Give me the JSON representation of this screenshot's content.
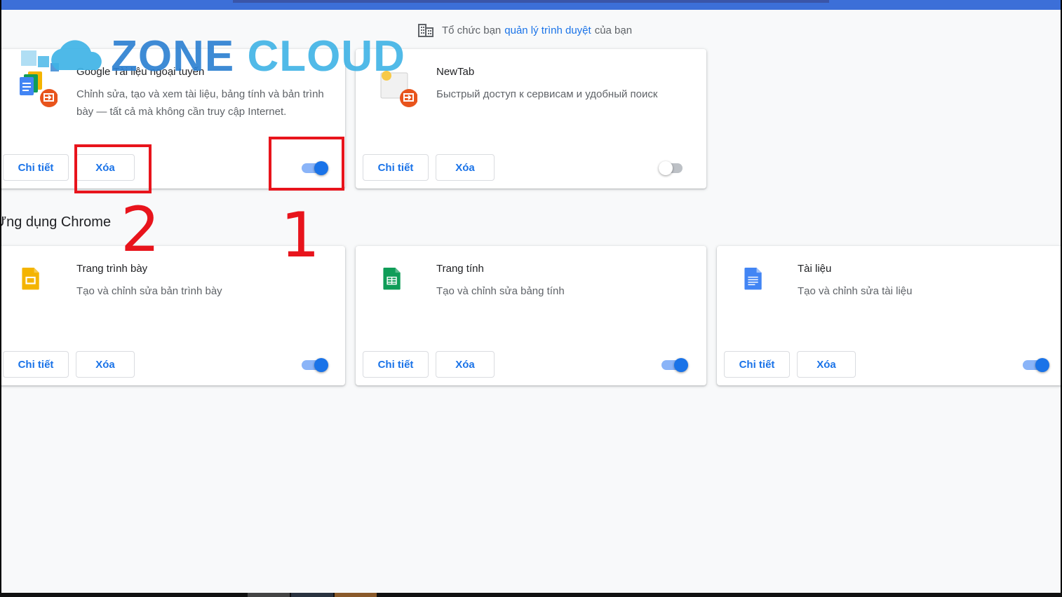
{
  "managed_notice": {
    "prefix": "Tổ chức bạn",
    "link": "quản lý trình duyệt",
    "suffix": "của bạn"
  },
  "extensions": [
    {
      "name": "Google Tài liệu ngoại tuyến",
      "description": "Chỉnh sửa, tạo và xem tài liệu, bảng tính và bản trình bày — tất cả mà không cần truy cập Internet.",
      "details_label": "Chi tiết",
      "remove_label": "Xóa",
      "enabled": true
    },
    {
      "name": "NewTab",
      "description": "Быстрый доступ к сервисам и удобный поиск",
      "details_label": "Chi tiết",
      "remove_label": "Xóa",
      "enabled": false
    }
  ],
  "chrome_apps_section": {
    "title": "Ứng dụng Chrome"
  },
  "apps": [
    {
      "name": "Trang trình bày",
      "description": "Tạo và chỉnh sửa bản trình bày",
      "details_label": "Chi tiết",
      "remove_label": "Xóa",
      "enabled": true,
      "icon": "google-slides-icon"
    },
    {
      "name": "Trang tính",
      "description": "Tạo và chỉnh sửa bảng tính",
      "details_label": "Chi tiết",
      "remove_label": "Xóa",
      "enabled": true,
      "icon": "google-sheets-icon"
    },
    {
      "name": "Tài liệu",
      "description": "Tạo và chỉnh sửa tài liệu",
      "details_label": "Chi tiết",
      "remove_label": "Xóa",
      "enabled": true,
      "icon": "google-docs-icon"
    }
  ],
  "annotations": {
    "marker_1": "1",
    "marker_2": "2"
  },
  "watermark": {
    "word1": "ZONE",
    "word2": "CLOUD"
  },
  "colors": {
    "accent": "#1a73e8",
    "annotation": "#e8141c",
    "topbar": "#3c6fd8"
  }
}
